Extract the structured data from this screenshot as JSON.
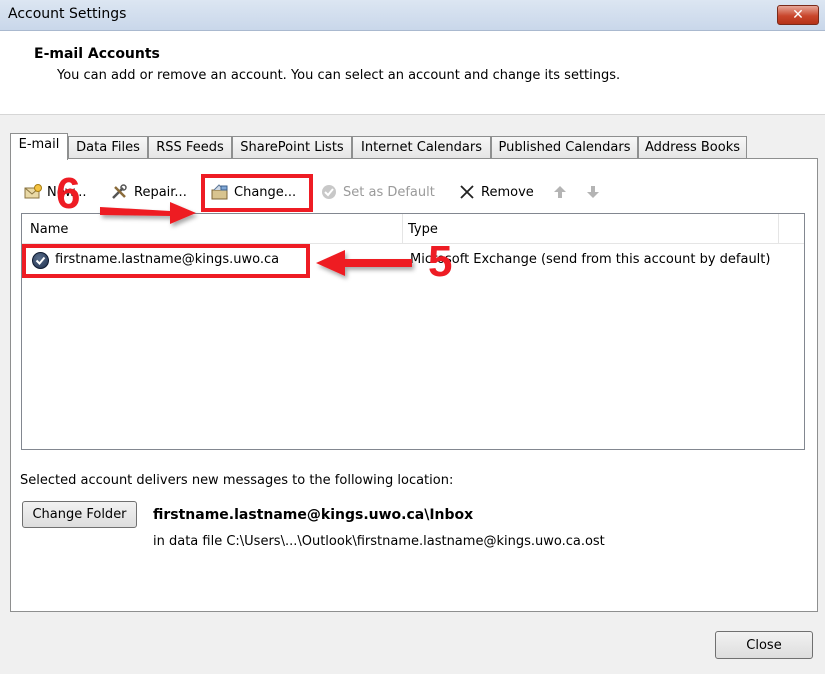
{
  "window": {
    "title": "Account Settings",
    "close_glyph": "✕"
  },
  "header": {
    "title": "E-mail Accounts",
    "description": "You can add or remove an account. You can select an account and change its settings."
  },
  "tabs": [
    {
      "label": "E-mail",
      "active": true
    },
    {
      "label": "Data Files"
    },
    {
      "label": "RSS Feeds"
    },
    {
      "label": "SharePoint Lists"
    },
    {
      "label": "Internet Calendars"
    },
    {
      "label": "Published Calendars"
    },
    {
      "label": "Address Books"
    }
  ],
  "toolbar": {
    "new_label": "New...",
    "repair_label": "Repair...",
    "change_label": "Change...",
    "set_default_label": "Set as Default",
    "remove_label": "Remove"
  },
  "accounts_list": {
    "columns": {
      "name": "Name",
      "type": "Type"
    },
    "rows": [
      {
        "name": "firstname.lastname@kings.uwo.ca",
        "type": "Microsoft Exchange (send from this account by default)"
      }
    ]
  },
  "delivery": {
    "label": "Selected account delivers new messages to the following location:",
    "change_folder_label": "Change Folder",
    "folder_path": "firstname.lastname@kings.uwo.ca\\Inbox",
    "data_file": "in data file C:\\Users\\...\\Outlook\\firstname.lastname@kings.uwo.ca.ost"
  },
  "close_button_label": "Close",
  "annotations": {
    "step_change": "6",
    "step_account": "5",
    "color": "#ee1c24"
  }
}
